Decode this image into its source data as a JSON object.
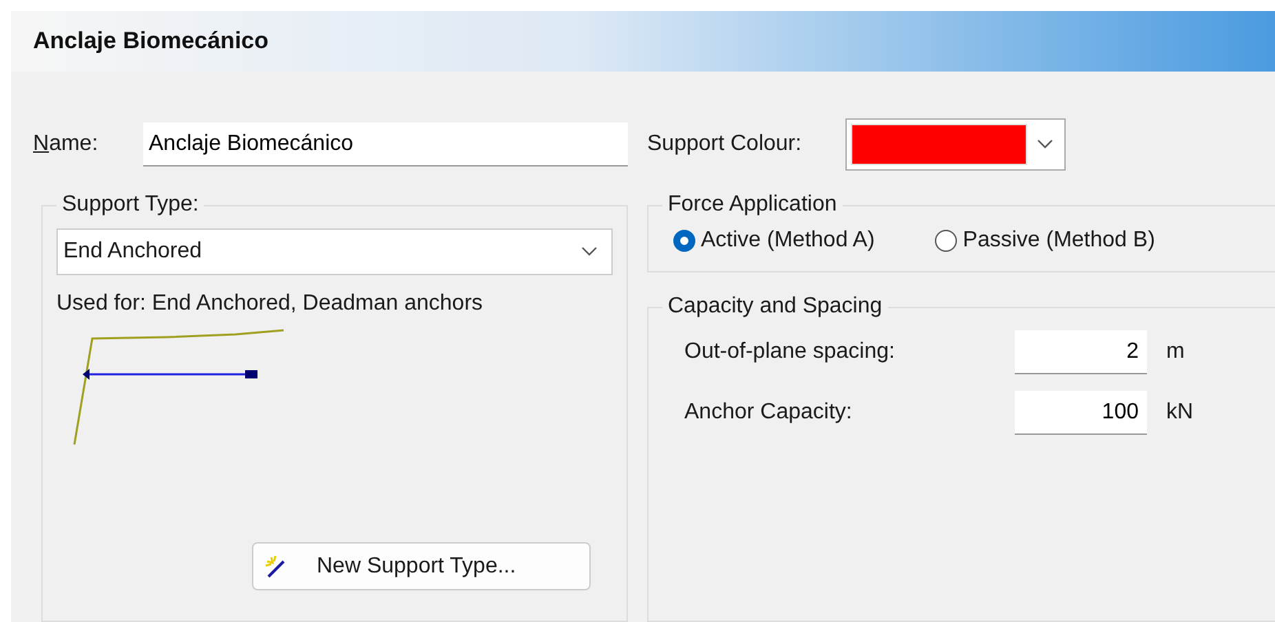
{
  "window": {
    "title": "Anclaje Biomecánico"
  },
  "name_field": {
    "label": "Name:",
    "value": "Anclaje Biomecánico"
  },
  "support_colour": {
    "label": "Support Colour:",
    "color": "#ff0000"
  },
  "support_type": {
    "legend": "Support Type:",
    "value": "End Anchored",
    "used_for": "Used for: End Anchored, Deadman anchors",
    "new_button": "New Support Type..."
  },
  "force_application": {
    "legend": "Force Application",
    "options": [
      {
        "label": "Active (Method A)",
        "selected": true
      },
      {
        "label": "Passive (Method B)",
        "selected": false
      }
    ]
  },
  "capacity_and_spacing": {
    "legend": "Capacity and Spacing",
    "fields": [
      {
        "label": "Out-of-plane spacing:",
        "value": "2",
        "unit": "m"
      },
      {
        "label": "Anchor Capacity:",
        "value": "100",
        "unit": "kN"
      }
    ]
  }
}
